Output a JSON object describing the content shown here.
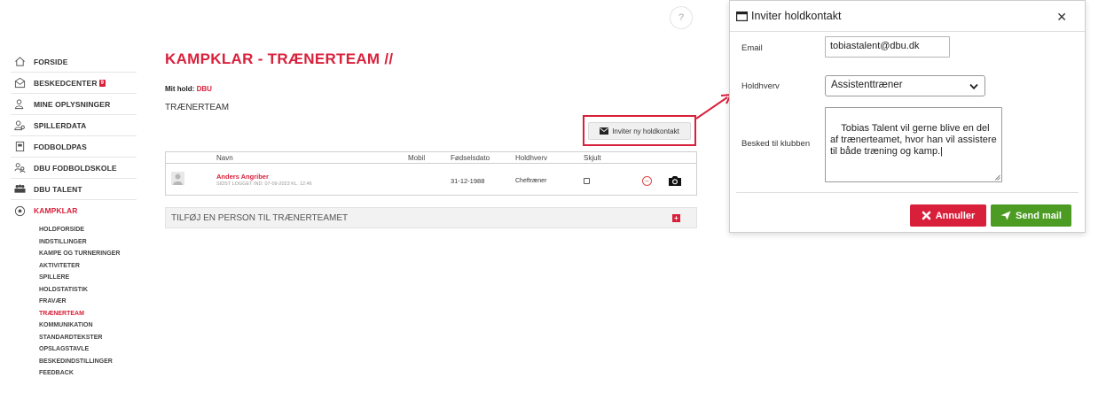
{
  "help": {
    "label": "?"
  },
  "sidebar": {
    "items": [
      {
        "label": "FORSIDE",
        "icon": "home-icon"
      },
      {
        "label": "BESKEDCENTER",
        "icon": "envelope-icon",
        "badge": "9"
      },
      {
        "label": "MINE OPLYSNINGER",
        "icon": "user-icon"
      },
      {
        "label": "SPILLERDATA",
        "icon": "users-icon"
      },
      {
        "label": "FODBOLDPAS",
        "icon": "id-card-icon"
      },
      {
        "label": "DBU FODBOLDSKOLE",
        "icon": "people-icon"
      },
      {
        "label": "DBU TALENT",
        "icon": "team-icon"
      },
      {
        "label": "KAMPKLAR",
        "icon": "football-icon",
        "active": true
      }
    ],
    "subitems": [
      "HOLDFORSIDE",
      "INDSTILLINGER",
      "KAMPE OG TURNERINGER",
      "AKTIVITETER",
      "SPILLERE",
      "HOLDSTATISTIK",
      "FRAVÆR",
      "TRÆNERTEAM",
      "KOMMUNIKATION",
      "STANDARDTEKSTER",
      "OPSLAGSTAVLE",
      "BESKEDINDSTILLINGER",
      "FEEDBACK"
    ],
    "active_subitem": "TRÆNERTEAM"
  },
  "main": {
    "title": "KAMPKLAR - TRÆNERTEAM //",
    "team_label": "Mit hold:",
    "team_value": "DBU",
    "subtitle": "TRÆNERTEAM",
    "invite_button": "Inviter ny holdkontakt",
    "table": {
      "headers": [
        "Navn",
        "Mobil",
        "Fødselsdato",
        "Holdhverv",
        "Skjult"
      ],
      "rows": [
        {
          "name": "Anders Angriber",
          "last_login": "SIDST LOGGET IND: 07-09-2023 KL. 12:46",
          "mobile": "",
          "birthdate": "31-12-1988",
          "role": "Cheftræner",
          "hidden": false
        }
      ]
    },
    "add_person": "TILFØJ EN PERSON TIL TRÆNERTEAMET"
  },
  "modal": {
    "title": "Inviter holdkontakt",
    "email_label": "Email",
    "email_value": "tobiastalent@dbu.dk",
    "role_label": "Holdhverv",
    "role_value": "Assistenttræner",
    "message_label": "Besked til klubben",
    "message_value": "Tobias Talent vil gerne blive en del af trænerteamet, hvor han vil assistere til både træning og kamp.",
    "cancel_label": "Annuller",
    "send_label": "Send mail"
  },
  "colors": {
    "accent": "#d9203b",
    "send": "#4c9b22"
  }
}
